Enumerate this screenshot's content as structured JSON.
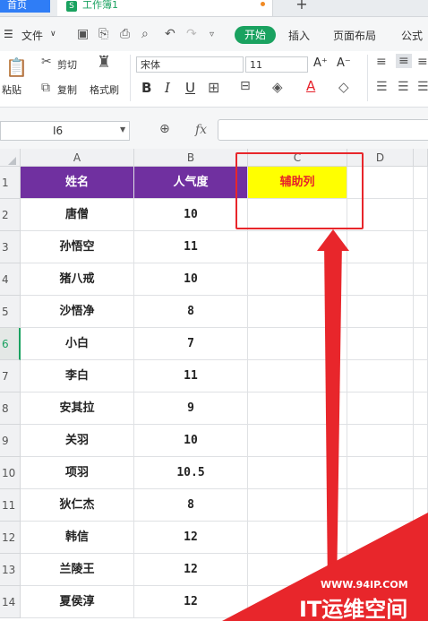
{
  "tabs": {
    "home": "首页",
    "workbook": "工作簿1",
    "workbook_icon": "S",
    "new_tab": "+"
  },
  "menu": {
    "file": "文件",
    "start": "开始",
    "insert": "插入",
    "page_layout": "页面布局",
    "formula": "公式"
  },
  "ribbon": {
    "paste": "粘贴",
    "cut": "剪切",
    "copy": "复制",
    "format_painter": "格式刷",
    "font_name": "宋体",
    "font_size": "11",
    "bold": "B",
    "italic": "I",
    "underline": "U",
    "font_grow": "A⁺",
    "font_shrink": "A⁻"
  },
  "formula_bar": {
    "cell_ref": "I6",
    "fx": "fx",
    "value": ""
  },
  "columns": [
    "A",
    "B",
    "C",
    "D"
  ],
  "header_row": {
    "name": "姓名",
    "popularity": "人气度",
    "helper": "辅助列"
  },
  "rows": [
    {
      "num": "1"
    },
    {
      "num": "2",
      "name": "唐僧",
      "value": "10"
    },
    {
      "num": "3",
      "name": "孙悟空",
      "value": "11"
    },
    {
      "num": "4",
      "name": "猪八戒",
      "value": "10"
    },
    {
      "num": "5",
      "name": "沙悟净",
      "value": "8"
    },
    {
      "num": "6",
      "name": "小白",
      "value": "7"
    },
    {
      "num": "7",
      "name": "李白",
      "value": "11"
    },
    {
      "num": "8",
      "name": "安其拉",
      "value": "9"
    },
    {
      "num": "9",
      "name": "关羽",
      "value": "10"
    },
    {
      "num": "10",
      "name": "项羽",
      "value": "10.5"
    },
    {
      "num": "11",
      "name": "狄仁杰",
      "value": "8"
    },
    {
      "num": "12",
      "name": "韩信",
      "value": "12"
    },
    {
      "num": "13",
      "name": "兰陵王",
      "value": "12"
    },
    {
      "num": "14",
      "name": "夏侯淳",
      "value": "12"
    }
  ],
  "active_row": "6",
  "watermark": {
    "url": "WWW.94IP.COM",
    "brand": "IT运维空间"
  },
  "colors": {
    "header_bg": "#7030a0",
    "helper_bg": "#ffff00",
    "helper_text": "#e6212a",
    "annotation": "#e8262b",
    "accent": "#1aa260"
  }
}
